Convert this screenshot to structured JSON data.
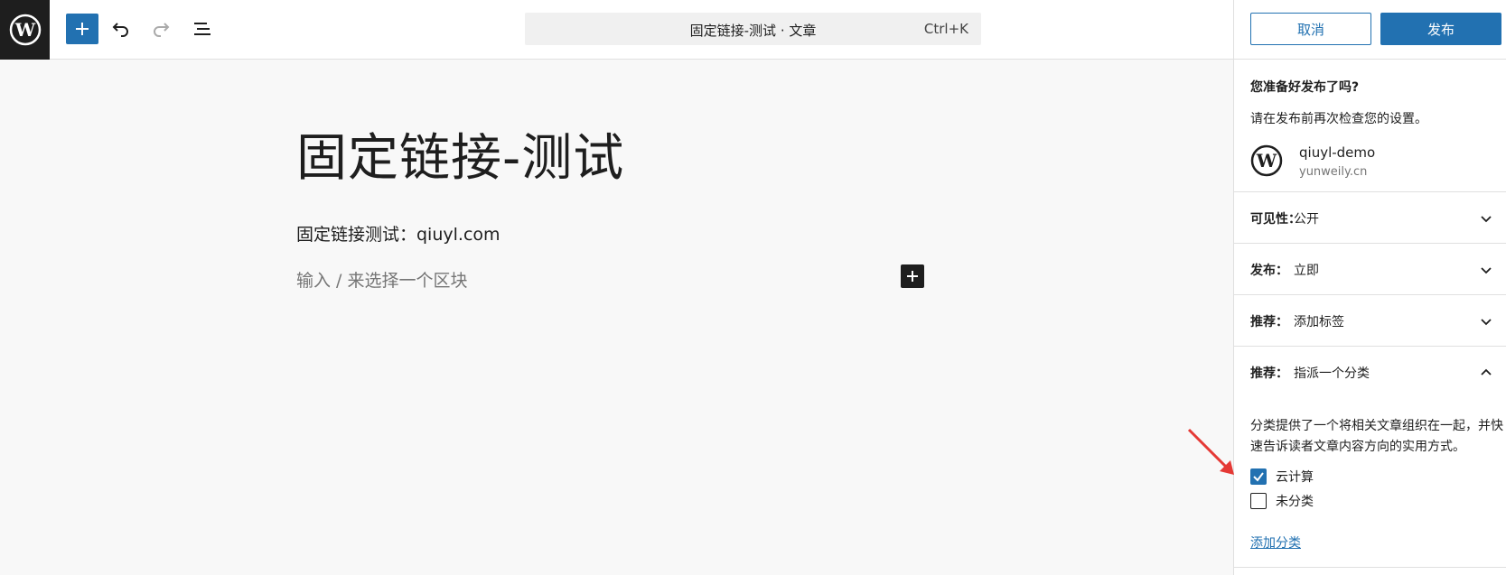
{
  "header": {
    "document_title": "固定链接-测试 · 文章",
    "shortcut": "Ctrl+K",
    "cancel_label": "取消",
    "publish_label": "发布"
  },
  "editor": {
    "post_title": "固定链接-测试",
    "paragraph": "固定链接测试：qiuyl.com",
    "block_placeholder": "输入 / 来选择一个区块"
  },
  "sidebar": {
    "heading": "您准备好发布了吗?",
    "subheading": "请在发布前再次检查您的设置。",
    "site_name": "qiuyl-demo",
    "site_url": "yunweily.cn",
    "panels": [
      {
        "label": "可见性：",
        "value": "公开",
        "expanded": false
      },
      {
        "label": "发布：",
        "value": "立即",
        "expanded": false
      },
      {
        "label": "推荐：",
        "value": "添加标签",
        "expanded": false
      },
      {
        "label": "推荐：",
        "value": "指派一个分类",
        "expanded": true
      }
    ],
    "category_description": "分类提供了一个将相关文章组织在一起，并快速告诉读者文章内容方向的实用方式。",
    "categories": [
      {
        "label": "云计算",
        "checked": true
      },
      {
        "label": "未分类",
        "checked": false
      }
    ],
    "add_category_label": "添加分类"
  },
  "colors": {
    "accent": "#2271b1",
    "dark": "#1e1e1e",
    "annotation_arrow": "#e53935"
  }
}
